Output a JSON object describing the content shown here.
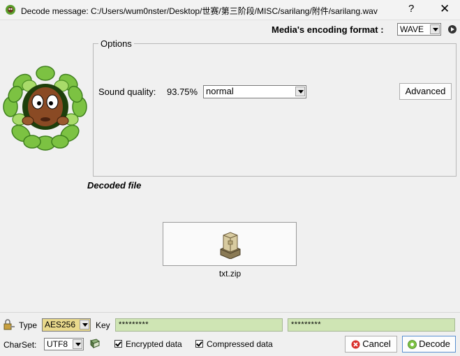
{
  "window": {
    "title": "Decode message: C:/Users/wum0nster/Desktop/世赛/第三阶段/MISC/sarilang/附件/sarilang.wav",
    "help_glyph": "?",
    "close_glyph": "✕"
  },
  "format": {
    "label": "Media's encoding format :",
    "value": "WAVE"
  },
  "options": {
    "title": "Options",
    "sound_quality_label": "Sound quality:",
    "sound_quality_value": "93.75%",
    "quality_selected": "normal",
    "advanced_label": "Advanced"
  },
  "decoded": {
    "label": "Decoded file",
    "file_name": "txt.zip"
  },
  "bottom": {
    "type_label": "Type",
    "type_value": "AES256",
    "key_label": "Key",
    "key_value": "*********",
    "key_confirm_value": "*********",
    "charset_label": "CharSet:",
    "charset_value": "UTF8",
    "encrypted_label": "Encrypted data",
    "encrypted_checked": true,
    "compressed_label": "Compressed data",
    "compressed_checked": true,
    "cancel_label": "Cancel",
    "decode_label": "Decode"
  }
}
